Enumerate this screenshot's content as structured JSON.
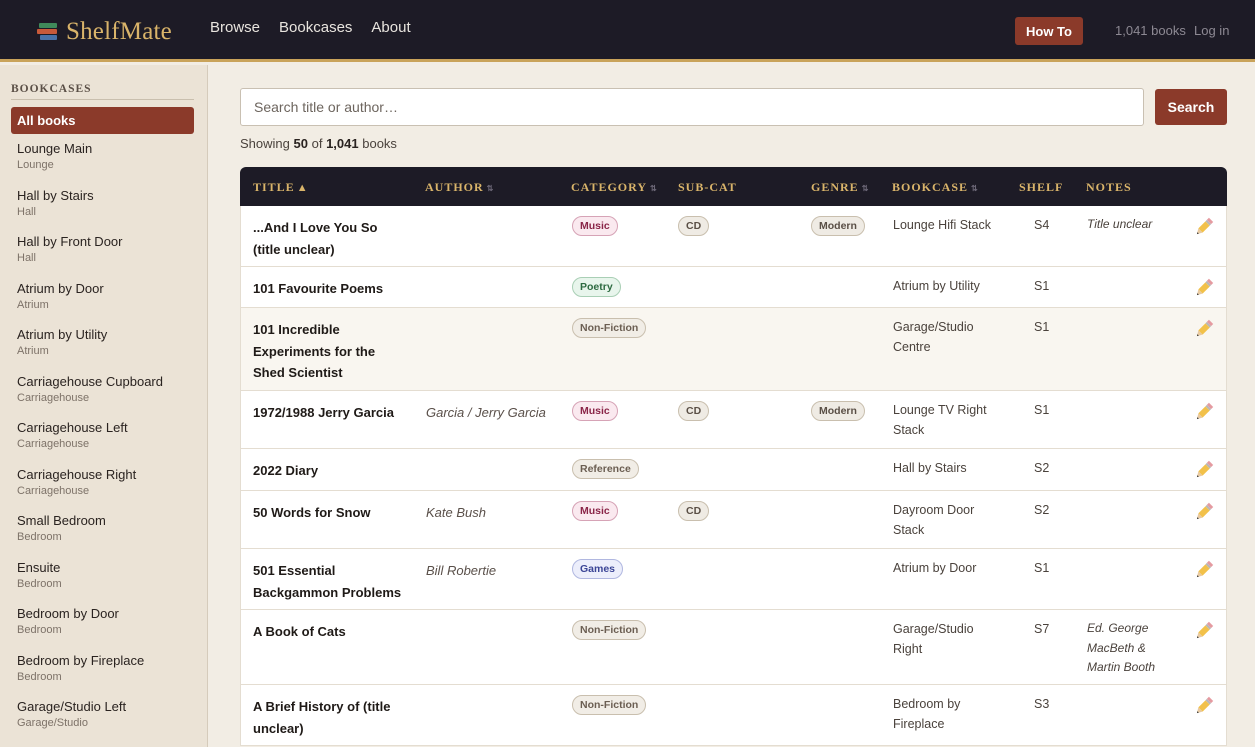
{
  "header": {
    "app_name": "ShelfMate",
    "logo_icon": "books-icon",
    "nav": [
      "Browse",
      "Bookcases",
      "About"
    ],
    "howto_label": "How To",
    "book_count": "1,041 books",
    "login_label": "Log in"
  },
  "sidebar": {
    "heading": "BOOKCASES",
    "all_label": "All books",
    "items": [
      {
        "name": "Lounge Main",
        "room": "Lounge"
      },
      {
        "name": "Hall by Stairs",
        "room": "Hall"
      },
      {
        "name": "Hall by Front Door",
        "room": "Hall"
      },
      {
        "name": "Atrium by Door",
        "room": "Atrium"
      },
      {
        "name": "Atrium by Utility",
        "room": "Atrium"
      },
      {
        "name": "Carriagehouse Cupboard",
        "room": "Carriagehouse"
      },
      {
        "name": "Carriagehouse Left",
        "room": "Carriagehouse"
      },
      {
        "name": "Carriagehouse Right",
        "room": "Carriagehouse"
      },
      {
        "name": "Small Bedroom",
        "room": "Bedroom"
      },
      {
        "name": "Ensuite",
        "room": "Bedroom"
      },
      {
        "name": "Bedroom by Door",
        "room": "Bedroom"
      },
      {
        "name": "Bedroom by Fireplace",
        "room": "Bedroom"
      },
      {
        "name": "Garage/Studio Left",
        "room": "Garage/Studio"
      }
    ]
  },
  "search": {
    "placeholder": "Search title or author…",
    "button_label": "Search"
  },
  "showing": {
    "prefix": "Showing",
    "shown": "50",
    "of": "of",
    "total": "1,041",
    "suffix": "books"
  },
  "table": {
    "columns": {
      "title": "TITLE",
      "title_sort": "▲",
      "author": "AUTHOR",
      "category": "CATEGORY",
      "subcat": "SUB-CAT",
      "genre": "GENRE",
      "bookcase": "BOOKCASE",
      "shelf": "SHELF",
      "notes": "NOTES",
      "sort_icon": "⇅"
    },
    "rows": [
      {
        "title": "...And I Love You So (title unclear)",
        "author": "",
        "category": "Music",
        "subcat": "CD",
        "genre": "Modern",
        "bookcase": "Lounge Hifi Stack",
        "shelf": "S4",
        "notes": "Title unclear"
      },
      {
        "title": "101 Favourite Poems",
        "author": "",
        "category": "Poetry",
        "subcat": "",
        "genre": "",
        "bookcase": "Atrium by Utility",
        "shelf": "S1",
        "notes": ""
      },
      {
        "title": "101 Incredible Experiments for the Shed Scientist",
        "author": "",
        "category": "Non-Fiction",
        "subcat": "",
        "genre": "",
        "bookcase": "Garage/Studio Centre",
        "shelf": "S1",
        "notes": ""
      },
      {
        "title": "1972/1988 Jerry Garcia",
        "author": "Garcia / Jerry Garcia",
        "category": "Music",
        "subcat": "CD",
        "genre": "Modern",
        "bookcase": "Lounge TV Right Stack",
        "shelf": "S1",
        "notes": ""
      },
      {
        "title": "2022 Diary",
        "author": "",
        "category": "Reference",
        "subcat": "",
        "genre": "",
        "bookcase": "Hall by Stairs",
        "shelf": "S2",
        "notes": ""
      },
      {
        "title": "50 Words for Snow",
        "author": "Kate Bush",
        "category": "Music",
        "subcat": "CD",
        "genre": "",
        "bookcase": "Dayroom Door Stack",
        "shelf": "S2",
        "notes": ""
      },
      {
        "title": "501 Essential Backgammon Problems",
        "author": "Bill Robertie",
        "category": "Games",
        "subcat": "",
        "genre": "",
        "bookcase": "Atrium by Door",
        "shelf": "S1",
        "notes": ""
      },
      {
        "title": "A Book of Cats",
        "author": "",
        "category": "Non-Fiction",
        "subcat": "",
        "genre": "",
        "bookcase": "Garage/Studio Right",
        "shelf": "S7",
        "notes": "Ed. George MacBeth & Martin Booth"
      },
      {
        "title": "A Brief History of (title unclear)",
        "author": "",
        "category": "Non-Fiction",
        "subcat": "",
        "genre": "",
        "bookcase": "Bedroom by Fireplace",
        "shelf": "S3",
        "notes": ""
      }
    ]
  },
  "edit_icon": "pencil-icon"
}
